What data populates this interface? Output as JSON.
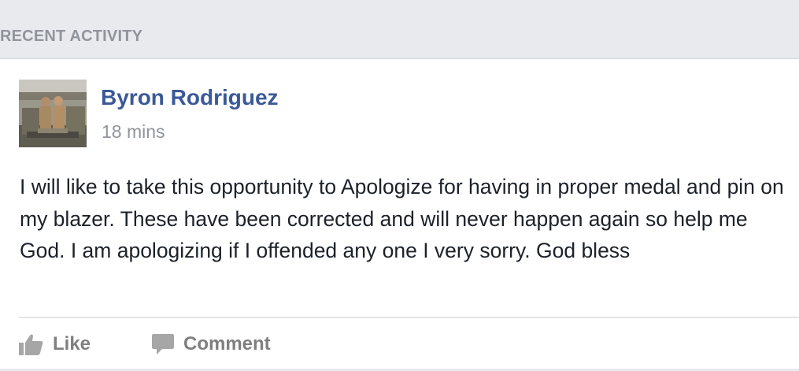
{
  "section": {
    "title": "RECENT ACTIVITY"
  },
  "post": {
    "author": "Byron Rodriguez",
    "timestamp": "18 mins",
    "text": "I will like to take this opportunity to Apologize for having in proper medal and pin on my blazer. These have been corrected and will never happen again so help me God. I am apologizing if I offended any one I very sorry. God bless",
    "avatar_icon": "profile-photo"
  },
  "actions": {
    "like_label": "Like",
    "like_icon": "thumbs-up-icon",
    "comment_label": "Comment",
    "comment_icon": "speech-bubble-icon"
  },
  "colors": {
    "author_link": "#3b5998",
    "muted_text": "#90949c",
    "action_text": "#7f7f7f",
    "header_bg": "#e9eaed"
  }
}
